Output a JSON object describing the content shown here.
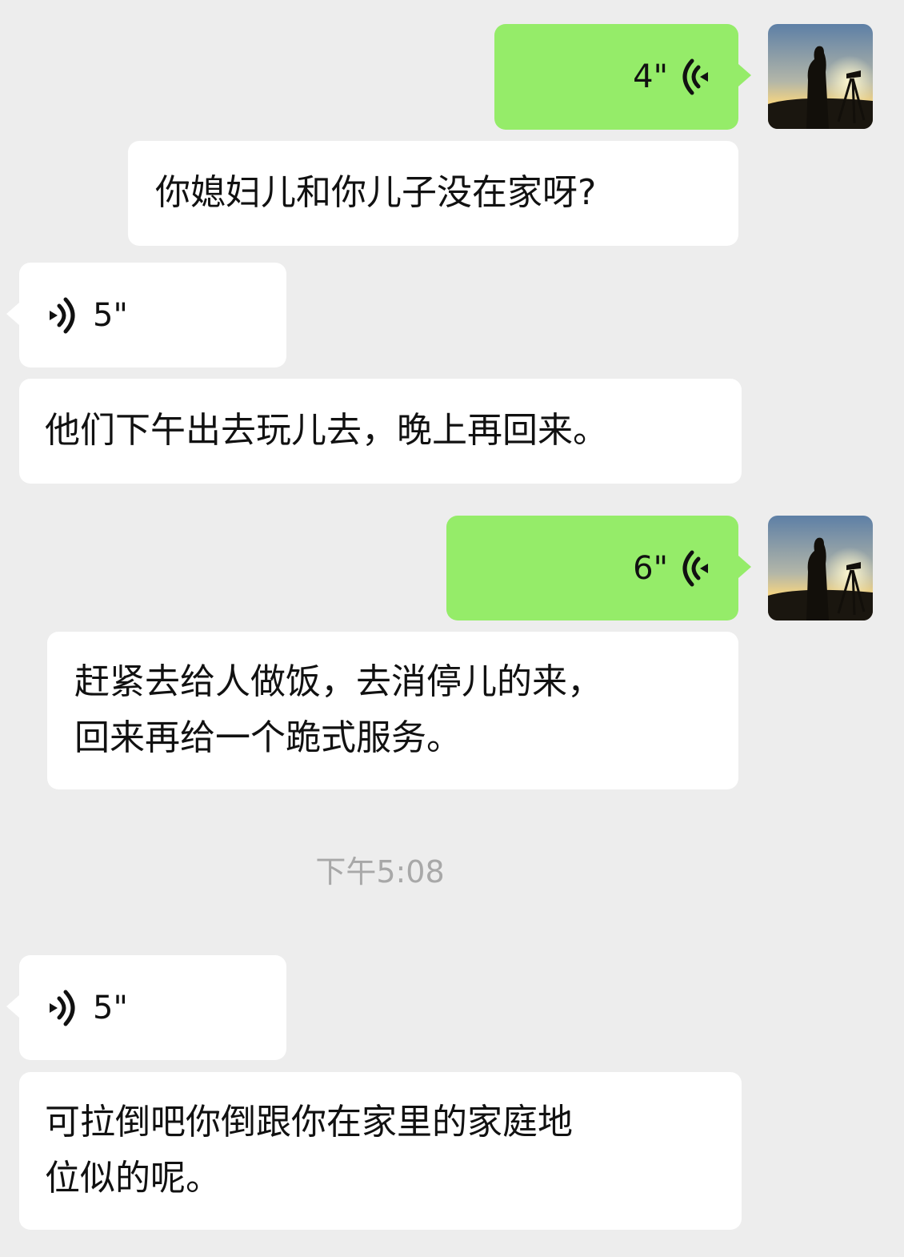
{
  "messages": [
    {
      "sender": "me",
      "type": "voice",
      "duration": "4\""
    },
    {
      "sender": "me",
      "type": "text",
      "text": "你媳妇儿和你儿子没在家呀?"
    },
    {
      "sender": "other",
      "type": "voice",
      "duration": "5\""
    },
    {
      "sender": "other",
      "type": "text",
      "text": "他们下午出去玩儿去，晚上再回来。"
    },
    {
      "sender": "me",
      "type": "voice",
      "duration": "6\""
    },
    {
      "sender": "me",
      "type": "text",
      "text": "赶紧去给人做饭，去消停儿的来，\n回来再给一个跪式服务。"
    },
    {
      "sender": "other",
      "type": "voice",
      "duration": "5\""
    },
    {
      "sender": "other",
      "type": "text",
      "text": "可拉倒吧你倒跟你在家里的家庭地\n位似的呢。"
    }
  ],
  "timestamp": "下午5:08",
  "colors": {
    "background": "#ededed",
    "my_bubble": "#95ec69",
    "other_bubble": "#ffffff",
    "timestamp": "#a8a8a8"
  },
  "icons": {
    "avatar": "avatar-silhouette-photographer-icon",
    "voice_out": "voice-wave-left-icon",
    "voice_in": "voice-wave-right-icon"
  }
}
